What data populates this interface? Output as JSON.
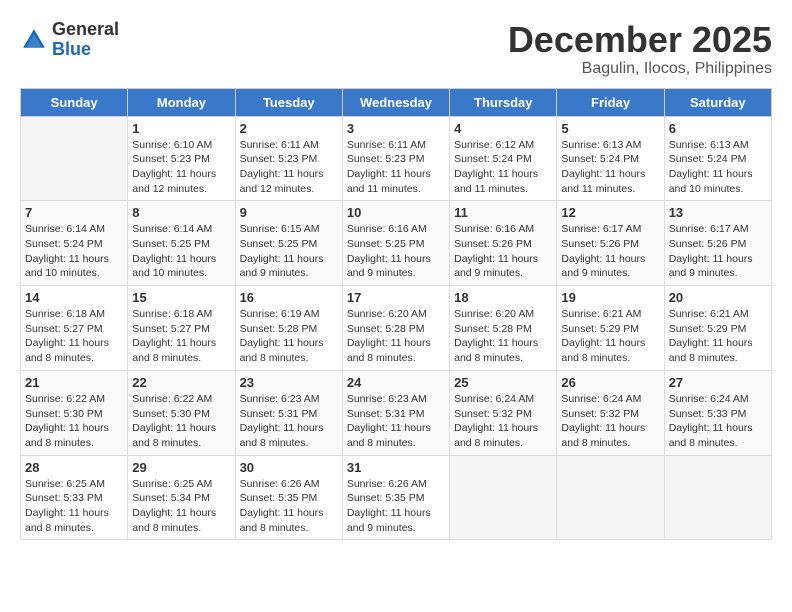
{
  "header": {
    "logo_general": "General",
    "logo_blue": "Blue",
    "month": "December 2025",
    "location": "Bagulin, Ilocos, Philippines"
  },
  "days_of_week": [
    "Sunday",
    "Monday",
    "Tuesday",
    "Wednesday",
    "Thursday",
    "Friday",
    "Saturday"
  ],
  "weeks": [
    [
      {
        "day": "",
        "content": ""
      },
      {
        "day": "1",
        "content": "Sunrise: 6:10 AM\nSunset: 5:23 PM\nDaylight: 11 hours\nand 12 minutes."
      },
      {
        "day": "2",
        "content": "Sunrise: 6:11 AM\nSunset: 5:23 PM\nDaylight: 11 hours\nand 12 minutes."
      },
      {
        "day": "3",
        "content": "Sunrise: 6:11 AM\nSunset: 5:23 PM\nDaylight: 11 hours\nand 11 minutes."
      },
      {
        "day": "4",
        "content": "Sunrise: 6:12 AM\nSunset: 5:24 PM\nDaylight: 11 hours\nand 11 minutes."
      },
      {
        "day": "5",
        "content": "Sunrise: 6:13 AM\nSunset: 5:24 PM\nDaylight: 11 hours\nand 11 minutes."
      },
      {
        "day": "6",
        "content": "Sunrise: 6:13 AM\nSunset: 5:24 PM\nDaylight: 11 hours\nand 10 minutes."
      }
    ],
    [
      {
        "day": "7",
        "content": "Sunrise: 6:14 AM\nSunset: 5:24 PM\nDaylight: 11 hours\nand 10 minutes."
      },
      {
        "day": "8",
        "content": "Sunrise: 6:14 AM\nSunset: 5:25 PM\nDaylight: 11 hours\nand 10 minutes."
      },
      {
        "day": "9",
        "content": "Sunrise: 6:15 AM\nSunset: 5:25 PM\nDaylight: 11 hours\nand 9 minutes."
      },
      {
        "day": "10",
        "content": "Sunrise: 6:16 AM\nSunset: 5:25 PM\nDaylight: 11 hours\nand 9 minutes."
      },
      {
        "day": "11",
        "content": "Sunrise: 6:16 AM\nSunset: 5:26 PM\nDaylight: 11 hours\nand 9 minutes."
      },
      {
        "day": "12",
        "content": "Sunrise: 6:17 AM\nSunset: 5:26 PM\nDaylight: 11 hours\nand 9 minutes."
      },
      {
        "day": "13",
        "content": "Sunrise: 6:17 AM\nSunset: 5:26 PM\nDaylight: 11 hours\nand 9 minutes."
      }
    ],
    [
      {
        "day": "14",
        "content": "Sunrise: 6:18 AM\nSunset: 5:27 PM\nDaylight: 11 hours\nand 8 minutes."
      },
      {
        "day": "15",
        "content": "Sunrise: 6:18 AM\nSunset: 5:27 PM\nDaylight: 11 hours\nand 8 minutes."
      },
      {
        "day": "16",
        "content": "Sunrise: 6:19 AM\nSunset: 5:28 PM\nDaylight: 11 hours\nand 8 minutes."
      },
      {
        "day": "17",
        "content": "Sunrise: 6:20 AM\nSunset: 5:28 PM\nDaylight: 11 hours\nand 8 minutes."
      },
      {
        "day": "18",
        "content": "Sunrise: 6:20 AM\nSunset: 5:28 PM\nDaylight: 11 hours\nand 8 minutes."
      },
      {
        "day": "19",
        "content": "Sunrise: 6:21 AM\nSunset: 5:29 PM\nDaylight: 11 hours\nand 8 minutes."
      },
      {
        "day": "20",
        "content": "Sunrise: 6:21 AM\nSunset: 5:29 PM\nDaylight: 11 hours\nand 8 minutes."
      }
    ],
    [
      {
        "day": "21",
        "content": "Sunrise: 6:22 AM\nSunset: 5:30 PM\nDaylight: 11 hours\nand 8 minutes."
      },
      {
        "day": "22",
        "content": "Sunrise: 6:22 AM\nSunset: 5:30 PM\nDaylight: 11 hours\nand 8 minutes."
      },
      {
        "day": "23",
        "content": "Sunrise: 6:23 AM\nSunset: 5:31 PM\nDaylight: 11 hours\nand 8 minutes."
      },
      {
        "day": "24",
        "content": "Sunrise: 6:23 AM\nSunset: 5:31 PM\nDaylight: 11 hours\nand 8 minutes."
      },
      {
        "day": "25",
        "content": "Sunrise: 6:24 AM\nSunset: 5:32 PM\nDaylight: 11 hours\nand 8 minutes."
      },
      {
        "day": "26",
        "content": "Sunrise: 6:24 AM\nSunset: 5:32 PM\nDaylight: 11 hours\nand 8 minutes."
      },
      {
        "day": "27",
        "content": "Sunrise: 6:24 AM\nSunset: 5:33 PM\nDaylight: 11 hours\nand 8 minutes."
      }
    ],
    [
      {
        "day": "28",
        "content": "Sunrise: 6:25 AM\nSunset: 5:33 PM\nDaylight: 11 hours\nand 8 minutes."
      },
      {
        "day": "29",
        "content": "Sunrise: 6:25 AM\nSunset: 5:34 PM\nDaylight: 11 hours\nand 8 minutes."
      },
      {
        "day": "30",
        "content": "Sunrise: 6:26 AM\nSunset: 5:35 PM\nDaylight: 11 hours\nand 8 minutes."
      },
      {
        "day": "31",
        "content": "Sunrise: 6:26 AM\nSunset: 5:35 PM\nDaylight: 11 hours\nand 9 minutes."
      },
      {
        "day": "",
        "content": ""
      },
      {
        "day": "",
        "content": ""
      },
      {
        "day": "",
        "content": ""
      }
    ]
  ]
}
